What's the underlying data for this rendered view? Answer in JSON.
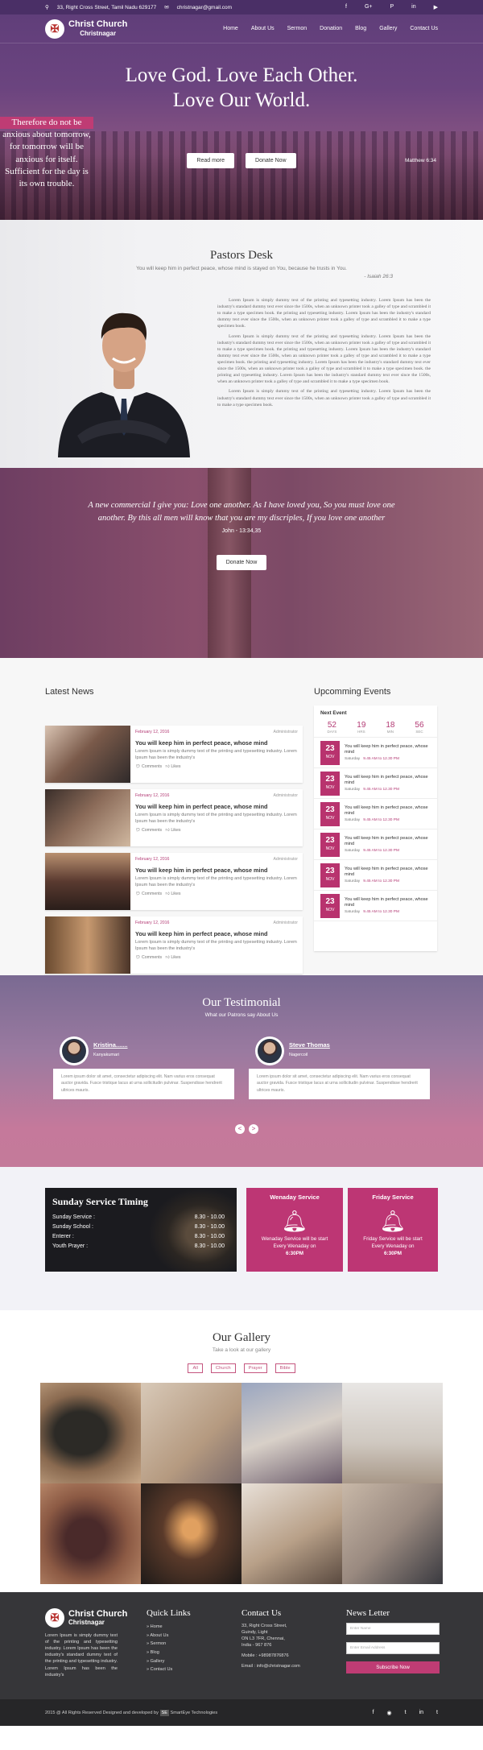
{
  "topbar": {
    "address": "33, Right Cross Street, Tamil Nadu 629177",
    "email": "christnagar@gmail.com",
    "social": [
      "f",
      "G+",
      "P",
      "in",
      "▶"
    ]
  },
  "brand": {
    "name": "Christ Church",
    "sub": "Christnagar",
    "seal": "✠"
  },
  "nav": [
    "Home",
    "About Us",
    "Sermon",
    "Donation",
    "Blog",
    "Gallery",
    "Contact Us"
  ],
  "hero": {
    "title1": "Love God. Love Each Other.",
    "title2": "Love Our World.",
    "sub1": "Therefore do not be anxious about tomorrow, for tomorrow will be anxious for itself.",
    "sub2": "Sufficient for the day is its own trouble.",
    "ref": "Matthew 6:34",
    "btn1": "Read more",
    "btn2": "Donate Now"
  },
  "pastor": {
    "title": "Pastors Desk",
    "quote": "You will keep him in perfect peace, whose mind is stayed on You, because he trusts in You.",
    "quote_ref": "- Isaiah 26:3",
    "p1": "Lorem Ipsum is simply dummy text of the printing and typesetting industry. Lorem Ipsum has been the industry's standard dummy text ever since the 1500s, when an unknown printer took a galley of type and scrambled it to make a type specimen book. the printing and typesetting industry. Lorem Ipsum has been the industry's standard dummy text ever since the 1500s, when an unknown printer took a galley of type and scrambled it to make a type specimen book.",
    "p2": "Lorem Ipsum is simply dummy text of the printing and typesetting industry. Lorem Ipsum has been the industry's standard dummy text ever since the 1500s, when an unknown printer took a galley of type and scrambled it to make a type specimen book. the printing and typesetting industry. Lorem Ipsum has been the industry's standard dummy text ever since the 1500s, when an unknown printer took a galley of type and scrambled it to make a type specimen book. the printing and typesetting industry. Lorem Ipsum has been the industry's standard dummy text ever since the 1500s, when an unknown printer took a galley of type and scrambled it to make a type specimen book. the printing and typesetting industry. Lorem Ipsum has been the industry's standard dummy text ever since the 1500s, when an unknown printer took a galley of type and scrambled it to make a type specimen book.",
    "p3": "Lorem Ipsum is simply dummy text of the printing and typesetting industry. Lorem Ipsum has been the industry's standard dummy text ever since the 1500s, when an unknown printer took a galley of type and scrambled it to make a type specimen book."
  },
  "qband": {
    "text": "A new commercial I give you: Love one another. As I have loved you, So you must love one another. By this all men will know that you are my discriples, If you love one another",
    "who": "John - 13:34,35",
    "btn": "Donate Now"
  },
  "news": {
    "title": "Latest News",
    "items": [
      {
        "date": "February 12, 2016",
        "author": "Administrator",
        "title": "You will keep him in perfect peace, whose mind",
        "text": "Lorem Ipsum is simply dummy text of the printing and typesetting industry. Lorem Ipsum has been the industry's",
        "comments": "Comments",
        "likes": "Likes"
      },
      {
        "date": "February 12, 2016",
        "author": "Administrator",
        "title": "You will keep him in perfect peace, whose mind",
        "text": "Lorem Ipsum is simply dummy text of the printing and typesetting industry. Lorem Ipsum has been the industry's",
        "comments": "Comments",
        "likes": "Likes"
      },
      {
        "date": "February 12, 2016",
        "author": "Administrator",
        "title": "You will keep him in perfect peace, whose mind",
        "text": "Lorem Ipsum is simply dummy text of the printing and typesetting industry. Lorem Ipsum has been the industry's",
        "comments": "Comments",
        "likes": "Likes"
      },
      {
        "date": "February 12, 2016",
        "author": "Administrator",
        "title": "You will keep him in perfect peace, whose mind",
        "text": "Lorem Ipsum is simply dummy text of the printing and typesetting industry. Lorem Ipsum has been the industry's",
        "comments": "Comments",
        "likes": "Likes"
      }
    ]
  },
  "events": {
    "title": "Upcomming Events",
    "next": "Next Event",
    "countdown": [
      {
        "n": "52",
        "l": "DAYS"
      },
      {
        "n": "19",
        "l": "HRS"
      },
      {
        "n": "18",
        "l": "MIN"
      },
      {
        "n": "56",
        "l": "SEC"
      }
    ],
    "items": [
      {
        "day": "23",
        "mon": "NOV",
        "title": "You will keep him in perfect peace, whose mind",
        "dow": "Saturday",
        "time": "9.45 AM to 12.30 PM"
      },
      {
        "day": "23",
        "mon": "NOV",
        "title": "You will keep him in perfect peace, whose mind",
        "dow": "Saturday",
        "time": "9.45 AM to 12.30 PM"
      },
      {
        "day": "23",
        "mon": "NOV",
        "title": "You will keep him in perfect peace, whose mind",
        "dow": "Saturday",
        "time": "9.45 AM to 12.30 PM"
      },
      {
        "day": "23",
        "mon": "NOV",
        "title": "You will keep him in perfect peace, whose mind",
        "dow": "Saturday",
        "time": "9.45 AM to 12.30 PM"
      },
      {
        "day": "23",
        "mon": "NOV",
        "title": "You will keep him in perfect peace, whose mind",
        "dow": "Saturday",
        "time": "9.45 AM to 12.30 PM"
      },
      {
        "day": "23",
        "mon": "NOV",
        "title": "You will keep him in perfect peace, whose mind",
        "dow": "Saturday",
        "time": "9.45 AM to 12.30 PM"
      }
    ]
  },
  "testimonial": {
    "title": "Our Testimonial",
    "sub": "What our Patrons say About Us",
    "items": [
      {
        "name": "Kristina.......",
        "place": "Kanyakumari",
        "text": "Lorem ipsum dolor sit amet, consectetur adipiscing elit. Nam varius eros consequat auctor gravida. Fusce tristique lacus at urna sollicitudin pulvinar. Suspendisse hendrerit ultrices mauris."
      },
      {
        "name": "Steve Thomas",
        "place": "Nagercoil",
        "text": "Lorem ipsum dolor sit amet, consectetur adipiscing elit. Nam varius eros consequat auctor gravida. Fusce tristique lacus at urna sollicitudin pulvinar. Suspendisse hendrerit ultrices mauris."
      }
    ],
    "prev": "<",
    "next": ">"
  },
  "service": {
    "title": "Sunday Service Timing",
    "rows": [
      {
        "label": "Sunday Service :",
        "time": "8.30 - 10.00"
      },
      {
        "label": "Sunday School :",
        "time": "8.30 - 10.00"
      },
      {
        "label": "Enterer :",
        "time": "8.30 - 10.00"
      },
      {
        "label": "Youth Prayer :",
        "time": "8.30 - 10.00"
      }
    ],
    "wed": {
      "title": "Wenaday Service",
      "text": "Wenaday Service will be start Every Wenaday on",
      "time": "6:30PM"
    },
    "fri": {
      "title": "Friday Service",
      "text": "Friday Service will be start Every Wenaday on",
      "time": "6:30PM"
    }
  },
  "gallery": {
    "title": "Our Gallery",
    "sub": "Take a look at our gallery",
    "filters": [
      "All",
      "Church",
      "Prayer",
      "Bible"
    ]
  },
  "footer": {
    "about": "Lorem Ipsum is simply dummy text of the printing and typesetting industry. Lorem Ipsum has been the industry's standard dummy text of the printing and typesetting industry. Lorem Ipsum has been the industry's",
    "quick_title": "Quick Links",
    "links": [
      "Home",
      "About Us",
      "Sermon",
      "Blog",
      "Gallery",
      "Contact Us"
    ],
    "contact_title": "Contact Us",
    "addr1": "33, Right Cross Street,",
    "addr2": "Guindy, Light",
    "addr3": "ON L3 7FR, Chennai,",
    "addr4": "India - 967 876",
    "mobile": "Mobile : +98987876876",
    "mail": "Email : info@christnagar.com",
    "news_title": "News Letter",
    "name_ph": "Enter Name",
    "email_ph": "Enter Email Address",
    "subscribe": "Subscribe Now",
    "copyright": "2015 @ All Rights Reserved Designed and developed by",
    "dev": "SmartEye Technologies",
    "social": [
      "f",
      "◉",
      "t",
      "in",
      "t"
    ]
  }
}
